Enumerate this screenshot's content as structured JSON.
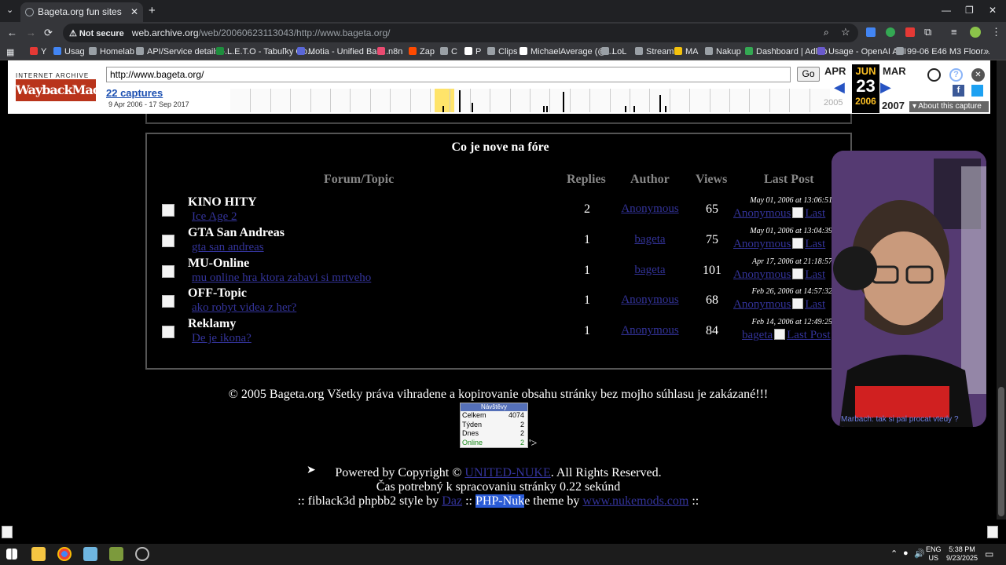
{
  "browser": {
    "tab_title": "Bageta.org fun sites",
    "tab_close": "✕",
    "new_tab": "+",
    "window_min": "—",
    "window_max": "❐",
    "window_close": "✕",
    "back": "←",
    "forward": "→",
    "reload": "⟳",
    "security_label": "Not secure",
    "address_host": "web.archive.org",
    "address_path": "/web/20060623113043/http://www.bageta.org/"
  },
  "bookmarks": [
    {
      "label": "Y",
      "icon": "youtube-icon",
      "color": "#e53935"
    },
    {
      "label": "Usag",
      "icon": "globe-icon",
      "color": "#4285f4"
    },
    {
      "label": "Homelab",
      "icon": "folder-icon",
      "color": "#9aa0a6"
    },
    {
      "label": "API/Service details -...",
      "icon": "gear-icon",
      "color": "#9aa0a6"
    },
    {
      "label": "L.E.T.O - Tabuľky Go...",
      "icon": "sheets-icon",
      "color": "#1e8e3e"
    },
    {
      "label": "Motia - Unified Bac...",
      "icon": "motia-icon",
      "color": "#5a67d8"
    },
    {
      "label": "n8n",
      "icon": "n8n-icon",
      "color": "#ea4b71"
    },
    {
      "label": "Zap",
      "icon": "zapier-icon",
      "color": "#ff4a00"
    },
    {
      "label": "C",
      "icon": "c-icon",
      "color": "#9aa0a6"
    },
    {
      "label": "P",
      "icon": "p-icon",
      "color": "#ffffff"
    },
    {
      "label": "Clips",
      "icon": "clips-icon",
      "color": "#9aa0a6"
    },
    {
      "label": "MichaelAverage (@...",
      "icon": "tiktok-icon",
      "color": "#ffffff"
    },
    {
      "label": "LoL",
      "icon": "folder-icon",
      "color": "#9aa0a6"
    },
    {
      "label": "Stream",
      "icon": "folder-icon",
      "color": "#9aa0a6"
    },
    {
      "label": "MA",
      "icon": "ma-icon",
      "color": "#f4c20d"
    },
    {
      "label": "Nakup",
      "icon": "folder-icon",
      "color": "#9aa0a6"
    },
    {
      "label": "Dashboard | Adlab",
      "icon": "adlab-icon",
      "color": "#34a853"
    },
    {
      "label": "Usage - OpenAI API",
      "icon": "openai-icon",
      "color": "#6a5acd"
    },
    {
      "label": "99-06 E46 M3 Floor...",
      "icon": "e46-icon",
      "color": "#9aa0a6"
    }
  ],
  "wayback": {
    "logo_top": "INTERNET ARCHIVE",
    "logo_main": "WaybackMachine",
    "url_value": "http://www.bageta.org/",
    "go_label": "Go",
    "captures_label": "22 captures",
    "date_range": "9 Apr 2006 - 17 Sep 2017",
    "prev_month": "APR",
    "cur_month": "JUN",
    "next_month": "MAR",
    "prev_year": "2005",
    "cur_day": "23",
    "cur_year": "2006",
    "next_year": "2007",
    "about_label": "About this capture",
    "prev_arrow": "◀",
    "next_arrow": "▶",
    "close_glyph": "✕",
    "help_glyph": "?",
    "fb_glyph": "f",
    "colors": {
      "accent": "#2754c3",
      "logo_red": "#b9341b",
      "highlight": "#ffe46a"
    }
  },
  "forum": {
    "title": "Co je nove na fóre",
    "headers": {
      "topic": "Forum/Topic",
      "replies": "Replies",
      "author": "Author",
      "views": "Views",
      "last": "Last Post"
    },
    "rows": [
      {
        "forum": "KINO HITY",
        "topic": "Ice Age 2",
        "replies": "2",
        "author": "Anonymous",
        "views": "65",
        "last_date": "May 01, 2006 at 13:06:51",
        "last_by": "Anonymous",
        "last_link": "Last"
      },
      {
        "forum": "GTA San Andreas",
        "topic": "gta san andreas",
        "replies": "1",
        "author": "bageta",
        "views": "75",
        "last_date": "May 01, 2006 at 13:04:39",
        "last_by": "Anonymous",
        "last_link": "Last"
      },
      {
        "forum": "MU-Online",
        "topic": "mu online hra ktora zabavi si mrtveho",
        "replies": "1",
        "author": "bageta",
        "views": "101",
        "last_date": "Apr 17, 2006 at 21:18:57",
        "last_by": "Anonymous",
        "last_link": "Last"
      },
      {
        "forum": "OFF-Topic",
        "topic": "ako robyt videa z her?",
        "replies": "1",
        "author": "Anonymous",
        "views": "68",
        "last_date": "Feb 26, 2006 at 14:57:32",
        "last_by": "Anonymous",
        "last_link": "Last"
      },
      {
        "forum": "Reklamy",
        "topic": "De je ikona?",
        "replies": "1",
        "author": "Anonymous",
        "views": "84",
        "last_date": "Feb 14, 2006 at 12:49:25",
        "last_by": "bageta",
        "last_link": "Last Post"
      }
    ]
  },
  "footer": {
    "copyright": "© 2005 Bageta.org Všetky práva vihradene a kopirovanie obsahu stránky bez mojho súhlasu je zakázané!!!",
    "counter": {
      "header": "Návštěvy",
      "rows": [
        {
          "label": "Celkem",
          "value": "4074"
        },
        {
          "label": "Týden",
          "value": "2"
        },
        {
          "label": "Dnes",
          "value": "2"
        },
        {
          "label": "Online",
          "value": "2"
        }
      ],
      "tail": "'>"
    },
    "powered_pre": "Powered by Copyright ©",
    "powered_link": "UNITED-NUKE",
    "powered_post": ". All Rights Reserved.",
    "timing": "Čas potrebný k spracovaniu stránky 0.22 sekúnd",
    "theme_1": ":: fiblack3d phpbb2 style by",
    "theme_dav": "Daz",
    "theme_2": "::",
    "theme_sel": "PHP-Nuk",
    "theme_3": "e theme by",
    "theme_link": "www.nukemods.com",
    "theme_4": "::"
  },
  "webcam": {
    "caption": "Marbach: tak si pal procat vtedy ?"
  },
  "taskbar": {
    "lang_line1": "ENG",
    "lang_line2": "US",
    "time": "5:38 PM",
    "date": "9/23/2025"
  }
}
